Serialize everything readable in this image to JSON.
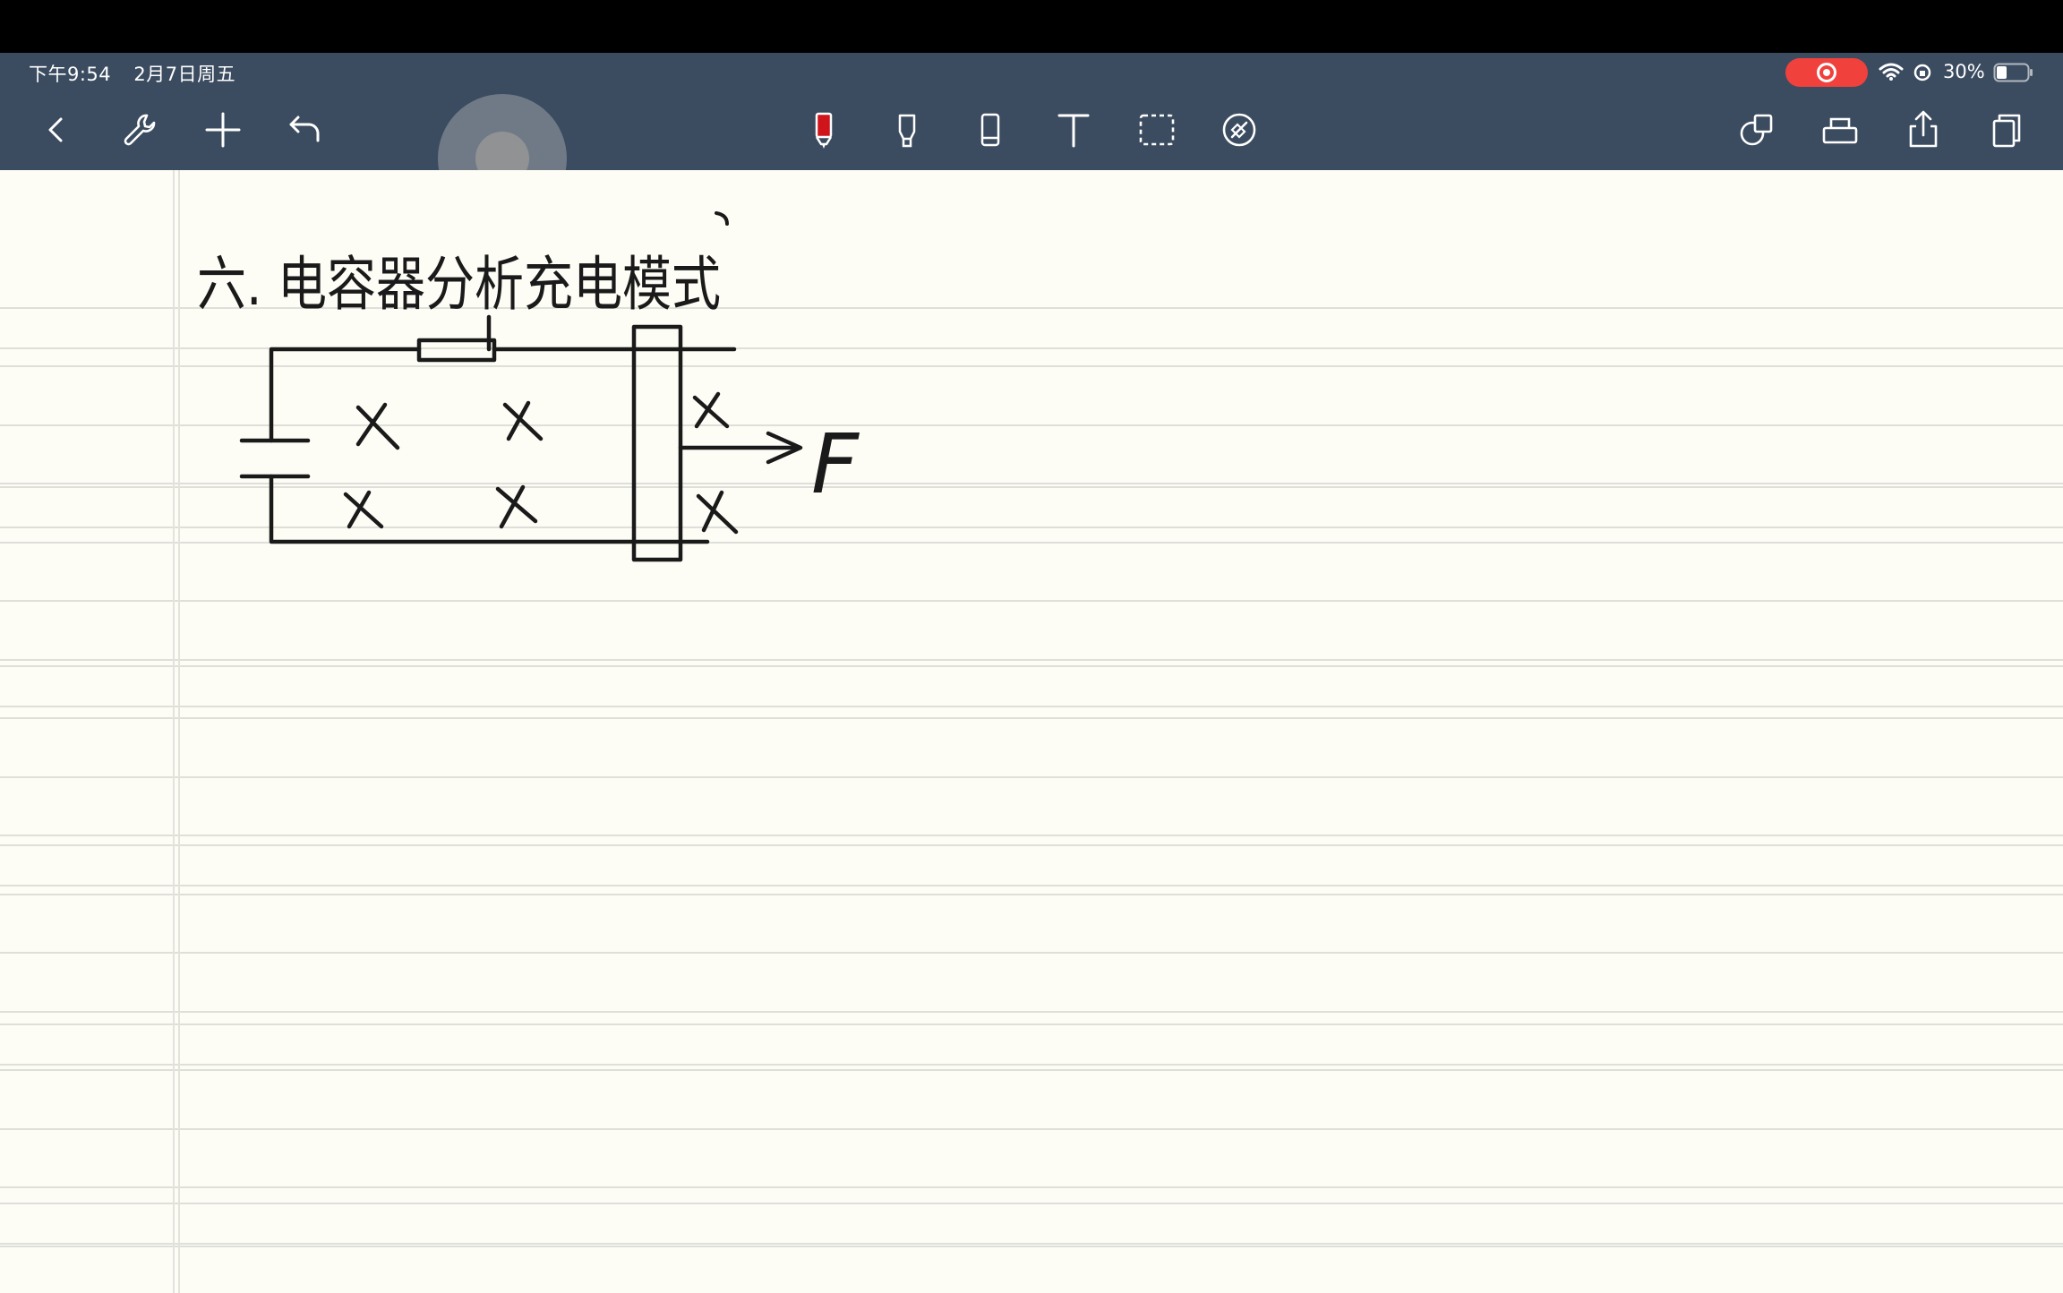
{
  "status_bar": {
    "time": "下午9:54",
    "date": "2月7日周五",
    "battery": "30%"
  },
  "toolbar": {
    "left_tools": [
      "back-icon",
      "wrench-icon",
      "plus-icon",
      "undo-icon"
    ],
    "center_tools": [
      "pen-icon",
      "highlighter-icon",
      "eraser-icon",
      "text-icon",
      "lasso-icon",
      "laser-pointer-icon"
    ],
    "right_tools": [
      "shapes-icon",
      "tray-icon",
      "share-icon",
      "pages-icon"
    ],
    "active_tool": "pen-icon",
    "pen_color": "#d0141b"
  },
  "note": {
    "heading": "六. 电容器分析充电模式",
    "force_label": "F"
  },
  "colors": {
    "chrome": "#3c4c60",
    "paper": "#fdfcf5",
    "rule_line": "#dfdfda",
    "record_indicator": "#f0413c",
    "ink": "#1a1a1a"
  }
}
